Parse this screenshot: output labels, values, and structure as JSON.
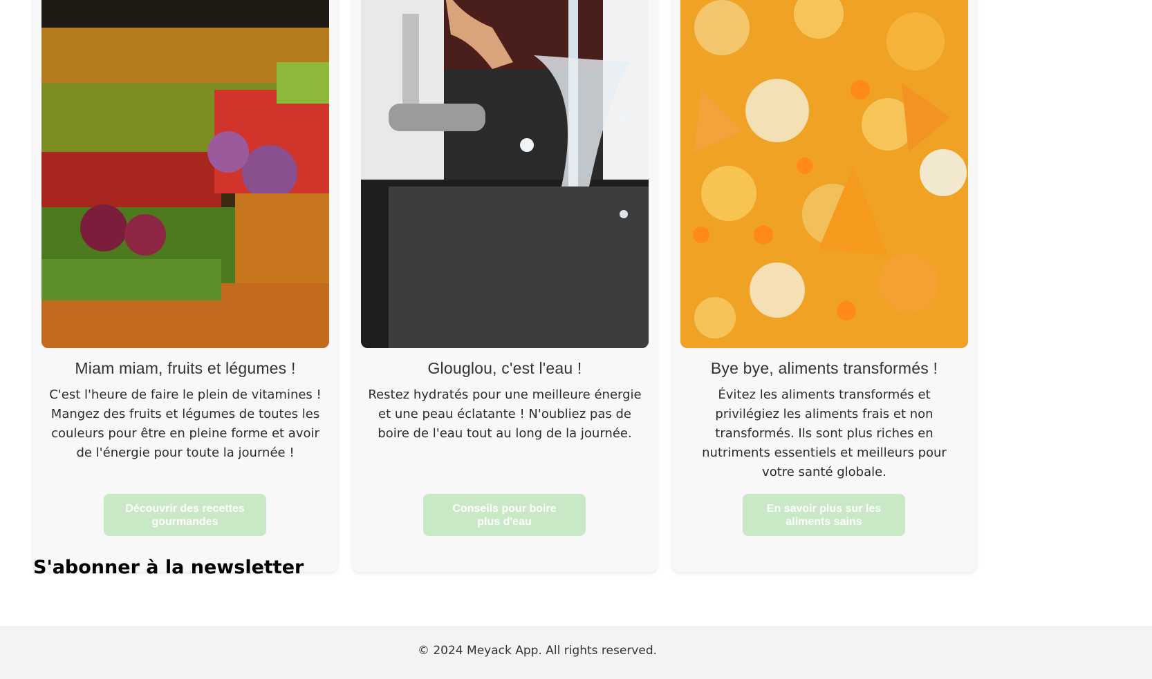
{
  "cards": [
    {
      "image_alt": "fruits-vegetables-market-photo",
      "title": "Miam miam, fruits et légumes !",
      "text": "C'est l'heure de faire le plein de vitamines ! Mangez des fruits et légumes de toutes les couleurs pour être en pleine forme et avoir de l'énergie pour toute la journée !",
      "button": "Découvrir des recettes gourmandes"
    },
    {
      "image_alt": "water-tap-glass-photo",
      "title": "Glouglou, c'est l'eau !",
      "text": "Restez hydratés pour une meilleure énergie et une peau éclatante ! N'oubliez pas de boire de l'eau tout au long de la journée.",
      "button": "Conseils pour boire plus d'eau"
    },
    {
      "image_alt": "processed-snacks-chips-photo",
      "title": "Bye bye, aliments transformés !",
      "text": "Évitez les aliments transformés et privilégiez les aliments frais et non transformés. Ils sont plus riches en nutriments essentiels et meilleurs pour votre santé globale.",
      "button": "En savoir plus sur les aliments sains"
    }
  ],
  "newsletter": {
    "title": "S'abonner à la newsletter"
  },
  "footer": {
    "copyright": "© 2024 Meyack App. All rights reserved."
  },
  "colors": {
    "button_bg": "#c9e9c6",
    "card_bg": "#f8f8f8",
    "footer_bg": "#f1f3f5"
  }
}
